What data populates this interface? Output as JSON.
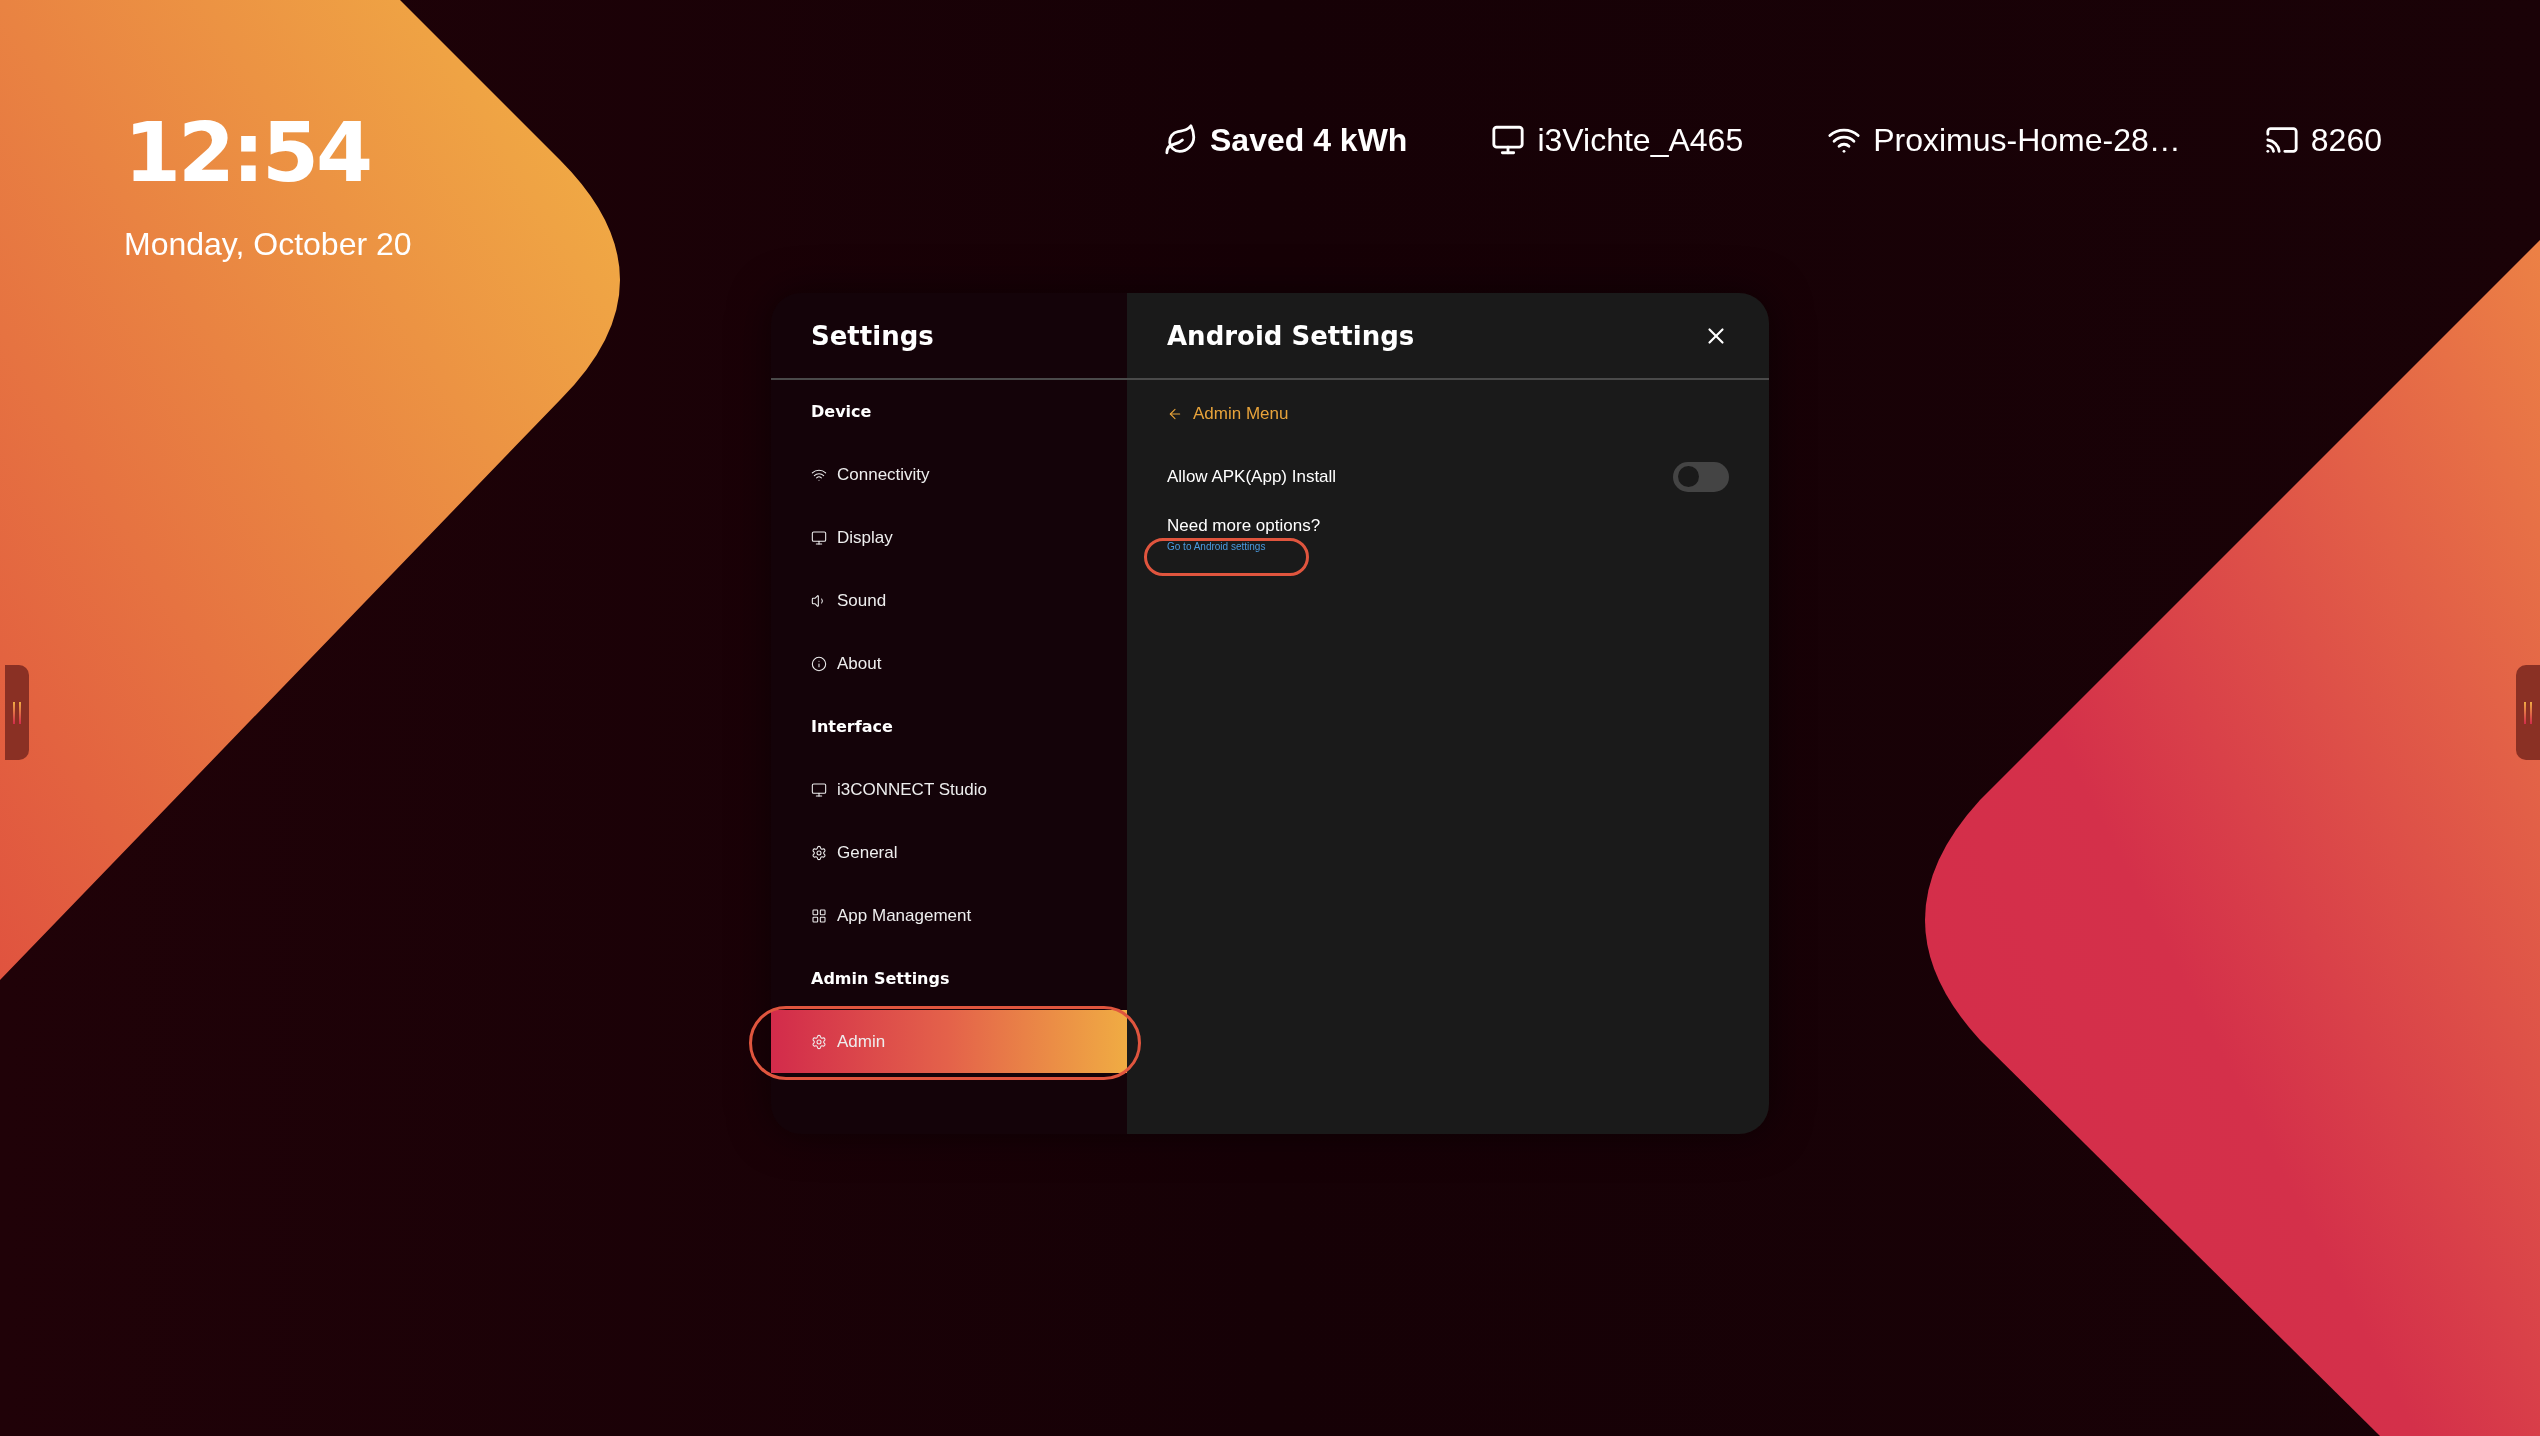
{
  "clock": {
    "time": "12:54",
    "date": "Monday, October 20"
  },
  "status_bar": [
    {
      "kind": "energy",
      "text": "Saved 4 kWh"
    },
    {
      "kind": "display",
      "text": "i3Vichte_A465"
    },
    {
      "kind": "wifi",
      "text": "Proximus-Home-28…"
    },
    {
      "kind": "cast",
      "text": "8260"
    }
  ],
  "settings": {
    "title": "Settings",
    "sections": [
      {
        "heading": "Device",
        "items": [
          {
            "kind": "wifi",
            "label": "Connectivity",
            "selected": false
          },
          {
            "kind": "display",
            "label": "Display",
            "selected": false
          },
          {
            "kind": "sound",
            "label": "Sound",
            "selected": false
          },
          {
            "kind": "info",
            "label": "About",
            "selected": false
          }
        ]
      },
      {
        "heading": "Interface",
        "items": [
          {
            "kind": "display",
            "label": "i3CONNECT Studio",
            "selected": false
          },
          {
            "kind": "gear",
            "label": "General",
            "selected": false
          },
          {
            "kind": "grid",
            "label": "App Management",
            "selected": false
          }
        ]
      },
      {
        "heading": "Admin Settings",
        "items": [
          {
            "kind": "gear",
            "label": "Admin",
            "selected": true
          }
        ]
      }
    ]
  },
  "panel": {
    "title": "Android Settings",
    "back_link": "Admin Menu",
    "options": [
      {
        "label": "Allow APK(App) Install",
        "on": false
      }
    ],
    "more_prompt": "Need more options?",
    "more_link": "Go to Android settings"
  }
}
